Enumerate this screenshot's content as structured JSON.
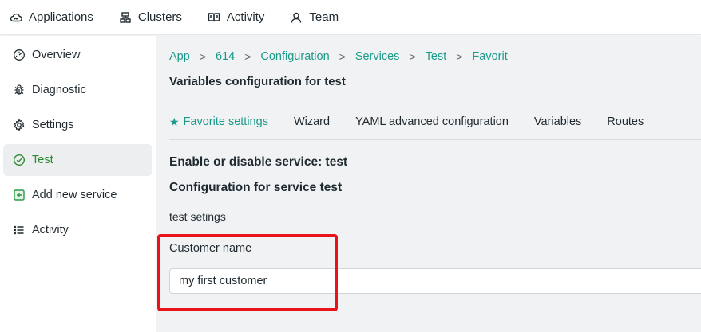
{
  "topnav": {
    "items": [
      {
        "label": "Applications",
        "icon": "cloud-icon"
      },
      {
        "label": "Clusters",
        "icon": "cluster-icon"
      },
      {
        "label": "Activity",
        "icon": "book-icon"
      },
      {
        "label": "Team",
        "icon": "user-icon"
      }
    ]
  },
  "sidebar": {
    "items": [
      {
        "label": "Overview",
        "icon": "gauge-icon"
      },
      {
        "label": "Diagnostic",
        "icon": "bug-icon"
      },
      {
        "label": "Settings",
        "icon": "gear-icon"
      },
      {
        "label": "Test",
        "icon": "check-circle-icon",
        "active": true
      },
      {
        "label": "Add new service",
        "icon": "plus-square-icon"
      },
      {
        "label": "Activity",
        "icon": "list-icon"
      }
    ]
  },
  "breadcrumb": [
    "App",
    "614",
    "Configuration",
    "Services",
    "Test",
    "Favorit"
  ],
  "page": {
    "title": "Variables configuration for test"
  },
  "tabs": [
    {
      "label": "Favorite settings",
      "active": true
    },
    {
      "label": "Wizard"
    },
    {
      "label": "YAML advanced configuration"
    },
    {
      "label": "Variables"
    },
    {
      "label": "Routes"
    }
  ],
  "content": {
    "enable_heading": "Enable or disable service: test",
    "config_heading": "Configuration for service test",
    "section_label": "test setings",
    "field_label": "Customer name",
    "field_value": "my first customer"
  },
  "colors": {
    "accent": "#1a9a8a",
    "active_green": "#2e8a2e",
    "highlight_red": "#e8141a"
  }
}
